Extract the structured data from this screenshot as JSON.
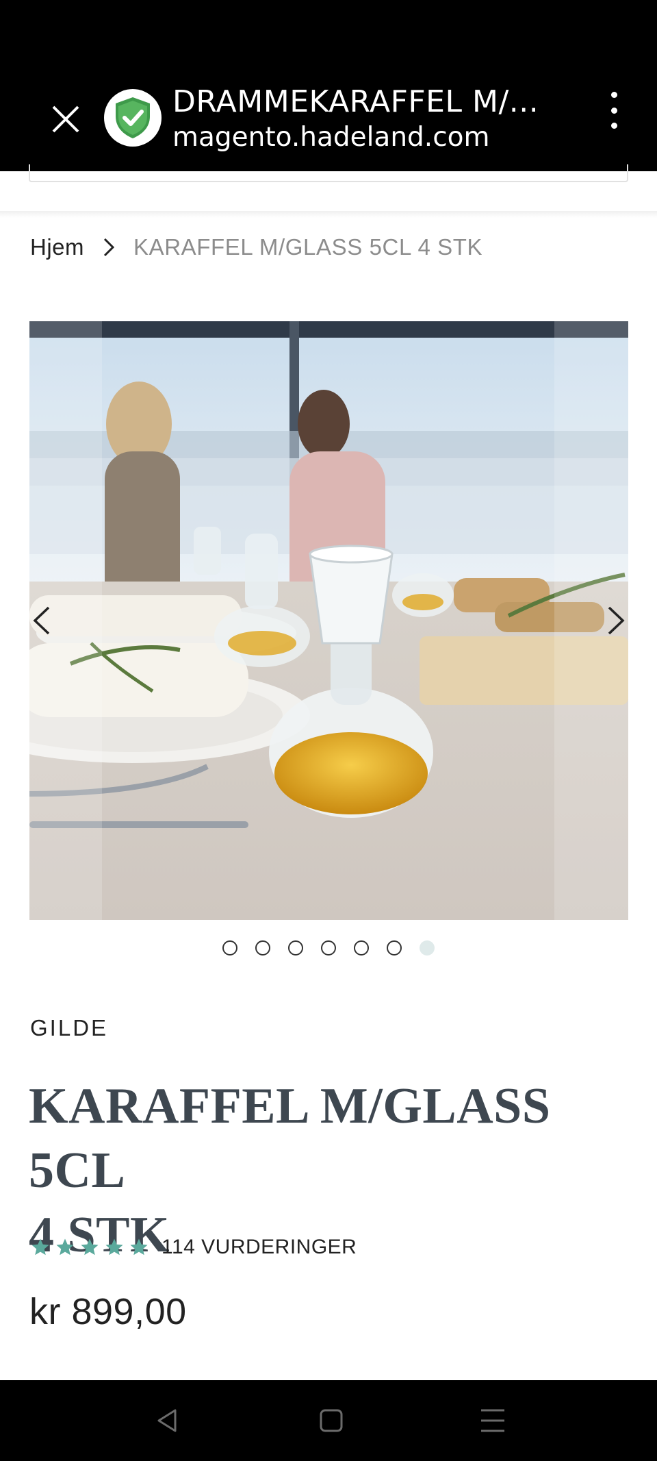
{
  "browser": {
    "page_title": "DRAMMEKARAFFEL M/...",
    "url": "magento.hadeland.com",
    "icons": {
      "close": "close-icon",
      "security": "shield-check-icon",
      "menu": "more-vert-icon"
    }
  },
  "breadcrumb": {
    "home": "Hjem",
    "current": "KARAFFEL M/GLASS 5CL 4 STK"
  },
  "gallery": {
    "dot_count": 7,
    "active_index": 6,
    "icons": {
      "prev": "chevron-left-icon",
      "next": "chevron-right-icon"
    }
  },
  "product": {
    "brand": "GILDE",
    "title_line1": "KARAFFEL M/GLASS 5CL",
    "title_line2": "4 STK",
    "rating_stars": 5,
    "reviews": "114 VURDERINGER",
    "price": "kr 899,00"
  },
  "colors": {
    "star": "#5aa99c",
    "title": "#3e4750",
    "breadcrumb_muted": "#8c8c8c"
  },
  "system_nav": {
    "icons": [
      "back-icon",
      "home-icon",
      "recent-apps-icon"
    ]
  }
}
